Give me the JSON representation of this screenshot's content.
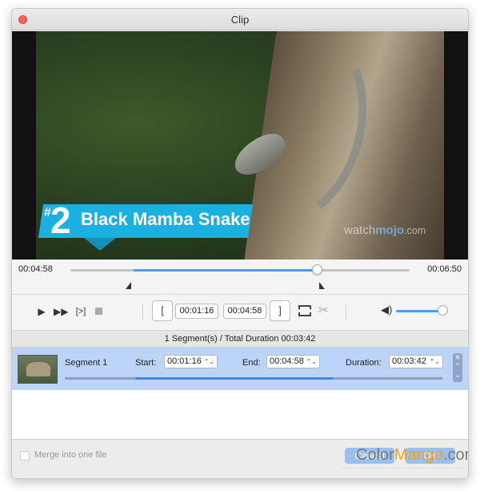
{
  "window": {
    "title": "Clip"
  },
  "video": {
    "banner_hash": "#",
    "banner_number": "2",
    "banner_text": "Black Mamba Snake",
    "watermark_a": "watch",
    "watermark_b": "mojo",
    "watermark_c": ".com"
  },
  "timeline": {
    "current_time": "00:04:58",
    "total_time": "00:06:50",
    "thumb_fraction": 0.727,
    "range_start_fraction": 0.186,
    "range_end_fraction": 0.727
  },
  "controls": {
    "start_bracket": "[",
    "start_time": "00:01:16",
    "end_time": "00:04:58",
    "end_bracket": "]",
    "step_label": "[>]",
    "volume_fraction": 1.0
  },
  "summary": "1 Segment(s) / Total Duration 00:03:42",
  "segments": [
    {
      "name": "Segment 1",
      "start_label": "Start:",
      "start": "00:01:16",
      "end_label": "End:",
      "end": "00:04:58",
      "duration_label": "Duration:",
      "duration": "00:03:42"
    }
  ],
  "footer": {
    "merge_label": "Merge into one file",
    "cancel_label": "Cancel",
    "ok_label": "OK",
    "brand_a": "Color",
    "brand_b": "Mango",
    "brand_c": ".com"
  },
  "colors": {
    "accent": "#4a9cf0",
    "selected_row": "#bcd4f7",
    "close_dot": "#fc615d"
  }
}
